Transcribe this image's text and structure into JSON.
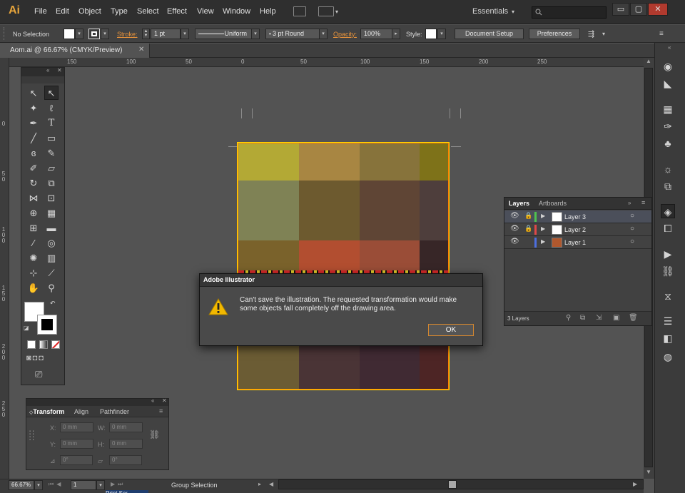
{
  "app": {
    "logo": "Ai"
  },
  "menu": [
    "File",
    "Edit",
    "Object",
    "Type",
    "Select",
    "Effect",
    "View",
    "Window",
    "Help"
  ],
  "workspace": {
    "label": "Essentials",
    "dropdown": "▾",
    "search_icon": "search-icon"
  },
  "window_controls": {
    "minimize": "▭",
    "restore": "▢",
    "close": "✕"
  },
  "control_bar": {
    "selection": "No Selection",
    "stroke_label": "Stroke:",
    "stroke_weight": "1 pt",
    "profile": "Uniform",
    "brush": "3 pt Round",
    "opacity_label": "Opacity:",
    "opacity_value": "100%",
    "style_label": "Style:",
    "doc_setup": "Document Setup",
    "preferences": "Preferences"
  },
  "document": {
    "tab_title": "Aom.ai @ 66.67% (CMYK/Preview)",
    "close": "✕"
  },
  "ruler_top": [
    "150",
    "100",
    "50",
    "0",
    "50",
    "100",
    "150",
    "200",
    "250"
  ],
  "ruler_left": [
    "0",
    "5 0",
    "1 0 0",
    "1 5 0",
    "2 0 0",
    "2 5 0"
  ],
  "artboard": {
    "cols": [
      0,
      85,
      170,
      254
    ],
    "colors": [
      [
        "#b3a935",
        "#a88642",
        "#87733b",
        "#7e7219"
      ],
      [
        "#7f8255",
        "#6d5a2f",
        "#5f4535",
        "#4e3e3c"
      ],
      [
        "#7a622b",
        "#b24e30",
        "#9a4d37",
        "#372627"
      ],
      [
        "#5a5330",
        "#3a2c36",
        "#484132",
        "#52342f"
      ],
      [
        "#6b5c34",
        "#4a3436",
        "#402a33",
        "#4d2525"
      ]
    ]
  },
  "dialog": {
    "title": "Adobe Illustrator",
    "message": "Can't save the illustration. The requested transformation would make some objects fall completely off the drawing area.",
    "ok": "OK"
  },
  "layers_panel": {
    "tabs": [
      "Layers",
      "Artboards"
    ],
    "rows": [
      {
        "name": "Layer 3",
        "color": "#4fc24f",
        "selected": true
      },
      {
        "name": "Layer 2",
        "color": "#e04848",
        "selected": false
      },
      {
        "name": "Layer 1",
        "color": "#4d6fe0",
        "selected": false
      }
    ],
    "count": "3 Layers"
  },
  "transform_panel": {
    "tabs": [
      "Transform",
      "Align",
      "Pathfinder"
    ],
    "x_label": "X:",
    "x": "0 mm",
    "y_label": "Y:",
    "y": "0 mm",
    "w_label": "W:",
    "w": "0 mm",
    "h_label": "H:",
    "h": "0 mm",
    "rotate": "0°",
    "shear": "0°"
  },
  "status": {
    "zoom": "66.67%",
    "page": "1",
    "mode": "Group Selection",
    "taskbar": "Print Scr"
  }
}
